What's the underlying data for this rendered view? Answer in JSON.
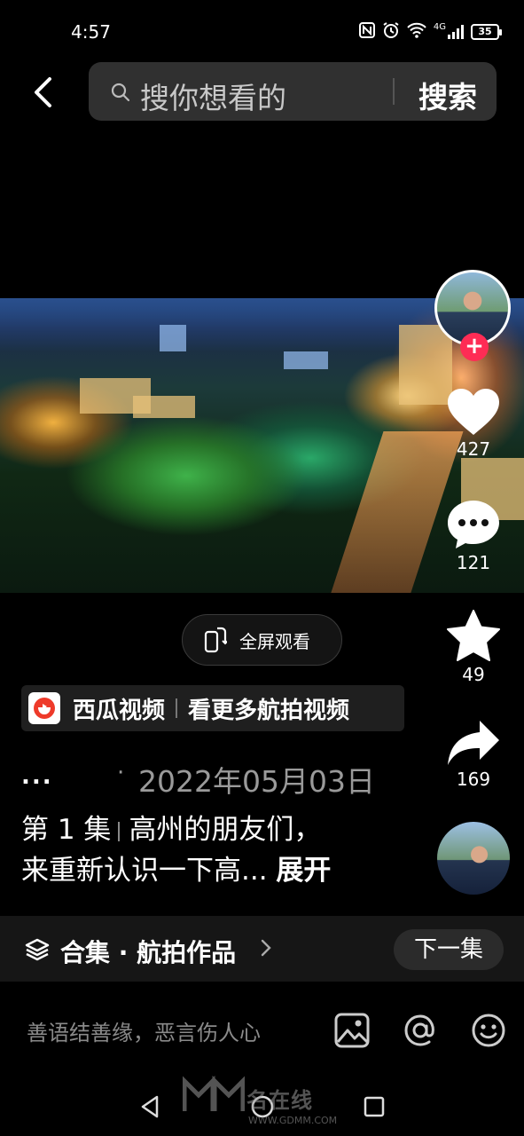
{
  "status_bar": {
    "time": "4:57",
    "network": "4G",
    "battery": "35"
  },
  "search": {
    "placeholder": "搜你想看的",
    "button_label": "搜索"
  },
  "actions": {
    "likes": "427",
    "comments": "121",
    "favorites": "49",
    "shares": "169"
  },
  "fullscreen": {
    "label": "全屏观看"
  },
  "source": {
    "name": "西瓜视频",
    "cta": "看更多航拍视频"
  },
  "meta": {
    "ellipsis": "...",
    "date_dot": "·",
    "date": "2022年05月03日"
  },
  "description": {
    "episode": "第 1 集",
    "text_line1": "高州的朋友们，",
    "text_line2": "来重新认识一下高...",
    "expand": "展开"
  },
  "collection": {
    "label": "合集 · 航拍作品",
    "next_button": "下一集"
  },
  "comment": {
    "placeholder": "善语结善缘，恶言伤人心"
  },
  "watermark": {
    "text": "名在线",
    "url": "WWW.GDMM.COM"
  },
  "colors": {
    "follow_accent": "#fe2c55",
    "xigua_red": "#ee3a2a",
    "background": "#000000"
  }
}
